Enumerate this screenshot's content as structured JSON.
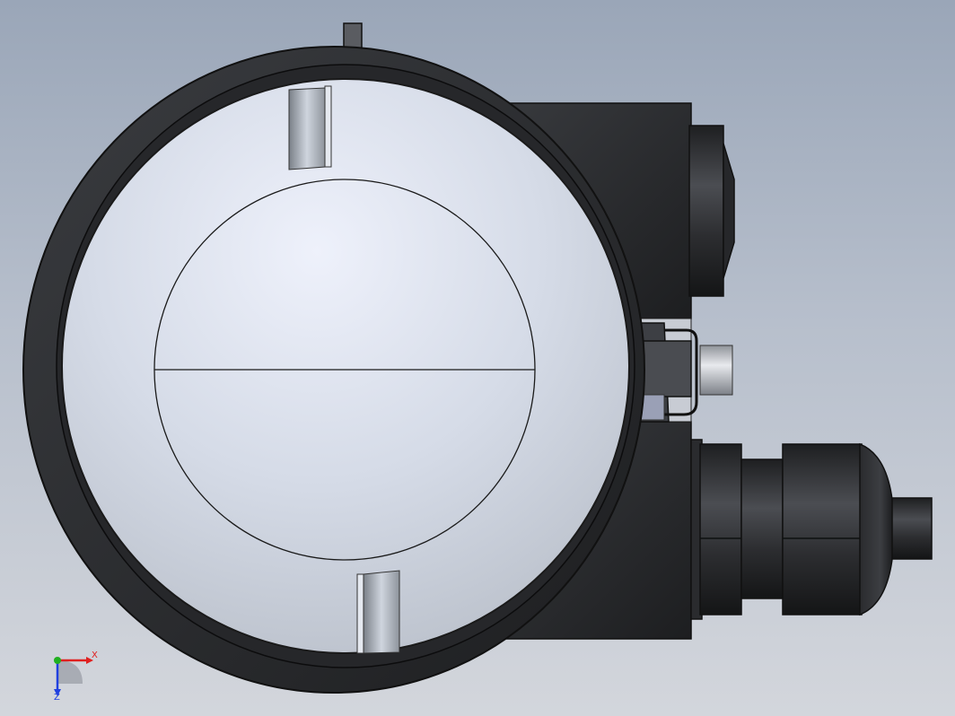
{
  "viewport": {
    "background_top": "#9aa6b8",
    "background_bottom": "#d3d6dc"
  },
  "model": {
    "housing_color": "#2b2d30",
    "housing_edge_color": "#141517",
    "cover_color": "#d2dae6",
    "inner_circle_line_color": "#1a1a1a"
  },
  "triad": {
    "x_label": "X",
    "z_label": "Z",
    "x_axis_color": "#e02020",
    "y_axis_color": "#20b020",
    "z_axis_color": "#2040e0"
  }
}
